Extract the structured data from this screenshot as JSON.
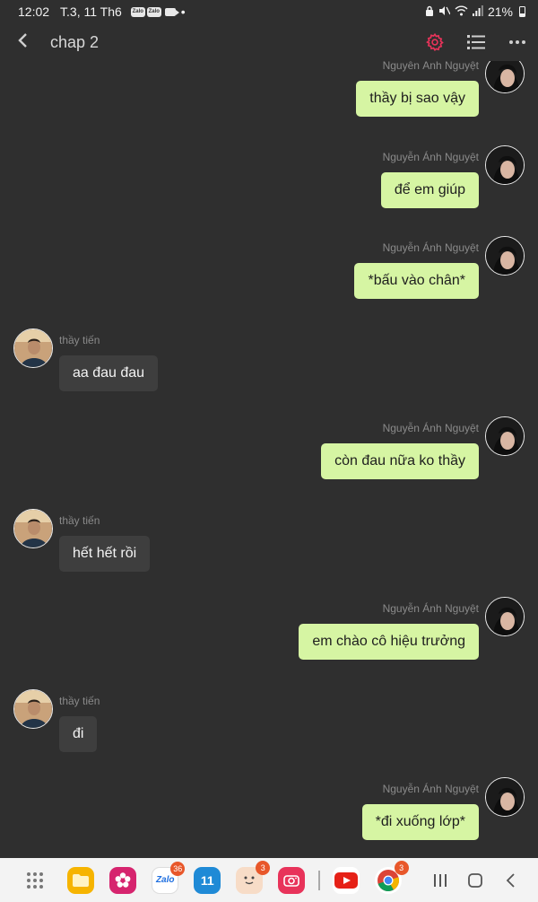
{
  "status_bar": {
    "time": "12:02",
    "date": "T.3, 11 Th6",
    "notif_badge_1": "Zalo",
    "notif_badge_2": "Zalo",
    "dot": "•",
    "battery": "21%"
  },
  "header": {
    "title": "chap 2"
  },
  "messages": [
    {
      "side": "out",
      "sender": "Nguyễn Ánh Nguyệt",
      "text": "thầy bị sao vậy"
    },
    {
      "side": "out",
      "sender": "Nguyễn Ánh Nguyệt",
      "text": "để em giúp"
    },
    {
      "side": "out",
      "sender": "Nguyễn Ánh Nguyệt",
      "text": "*bấu vào chân*"
    },
    {
      "side": "in",
      "sender": "thầy tiến",
      "text": "aa đau đau"
    },
    {
      "side": "out",
      "sender": "Nguyễn Ánh Nguyệt",
      "text": "còn đau nữa ko thầy"
    },
    {
      "side": "in",
      "sender": "thầy tiến",
      "text": "hết hết rồi"
    },
    {
      "side": "out",
      "sender": "Nguyễn Ánh Nguyệt",
      "text": "em chào cô hiệu trưởng"
    },
    {
      "side": "in",
      "sender": "thầy tiến",
      "text": "đi"
    },
    {
      "side": "out",
      "sender": "Nguyễn Ánh Nguyệt",
      "text": "*đi xuống lớp*"
    }
  ],
  "dock": {
    "apps": [
      {
        "name": "files-app-icon",
        "color": "#f6b400",
        "badge": ""
      },
      {
        "name": "blossom-app-icon",
        "color": "#d6246e",
        "badge": ""
      },
      {
        "name": "zalo-app-icon",
        "color": "#ffffff",
        "badge": "36",
        "label": "Zalo"
      },
      {
        "name": "calendar-app-icon",
        "color": "#1f8ad6",
        "badge": "",
        "label": "11"
      },
      {
        "name": "face-app-icon",
        "color": "#f7dcc7",
        "badge": "3"
      },
      {
        "name": "camera-app-icon",
        "color": "#e8335a",
        "badge": ""
      },
      {
        "name": "youtube-app-icon",
        "color": "#ffffff",
        "badge": ""
      },
      {
        "name": "chrome-app-icon",
        "color": "#ffffff",
        "badge": "3"
      }
    ]
  },
  "colors": {
    "background": "#2f2f2f",
    "outgoing_bubble": "#d6f5a3",
    "incoming_bubble": "#3e3e3e",
    "settings_accent": "#e8335a"
  }
}
